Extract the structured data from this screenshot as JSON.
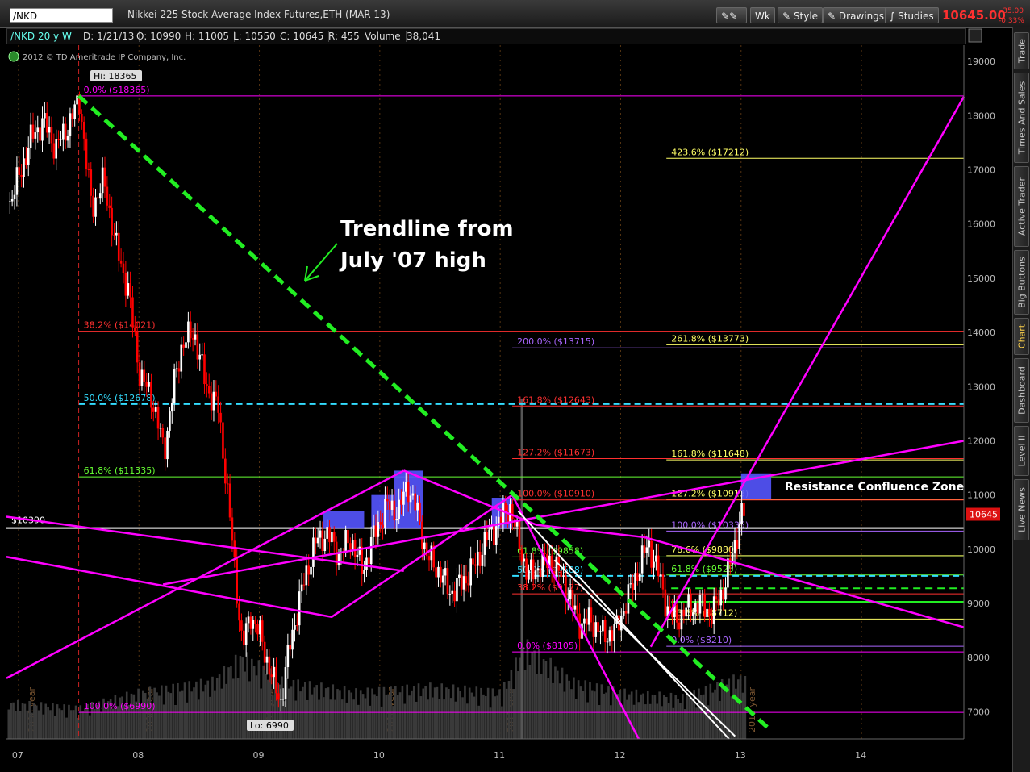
{
  "toolbar": {
    "symbol": "/NKD",
    "description": "Nikkei 225 Stock Average Index Futures,ETH (MAR 13)",
    "period_button": "Wk",
    "style_button": "Style",
    "drawings_button": "Drawings",
    "studies_button": "Studies",
    "last_price": "10645.00",
    "net_change": "-35.00",
    "pct_change": "-0.33%"
  },
  "infobar": {
    "symbol_period": "/NKD 20 y W",
    "date": "D: 1/21/13",
    "open": "O: 10990",
    "high": "H: 11005",
    "low": "L: 10550",
    "close": "C: 10645",
    "range": "R: 455",
    "volume_label": "Volume",
    "volume": "38,041"
  },
  "copyright": "2012 © TD Ameritrade IP Company, Inc.",
  "side_tabs": [
    "Trade",
    "Times And Sales",
    "Active Trader",
    "Big Buttons",
    "Chart",
    "Dashboard",
    "Level II",
    "Live News"
  ],
  "colors": {
    "bull": "#ffffff",
    "bear": "#ff0000",
    "fib_magenta": "#ff00ff",
    "fib_red": "#ff3030",
    "fib_yellow": "#ffff66",
    "fib_green": "#66ff33",
    "fib_cyan": "#33ddff",
    "fib_violet": "#aa66ff",
    "trend_green": "#22ee22",
    "zone_blue": "#5555ff",
    "volume": "#3a3a3a"
  },
  "chart_data": {
    "type": "candlestick",
    "instrument": "/NKD",
    "x_ticks": [
      "07",
      "08",
      "09",
      "10",
      "11",
      "12",
      "13",
      "14"
    ],
    "year_labels": [
      "2006 year",
      "2008 year",
      "2009 year",
      "2010 year",
      "2011 year",
      "2013 year"
    ],
    "y_ticks": [
      7000,
      8000,
      9000,
      10000,
      11000,
      12000,
      13000,
      14000,
      15000,
      16000,
      17000,
      18000,
      19000
    ],
    "ylim": [
      6500,
      19300
    ],
    "xlim": [
      2006.9,
      2014.85
    ],
    "high_label": "Hi: 18365",
    "low_label": "Lo: 6990",
    "current_price_label": "10645",
    "price_line_label": "$10390",
    "price_line_value": 10390,
    "price_path": [
      [
        2006.92,
        16400
      ],
      [
        2007.0,
        16900
      ],
      [
        2007.1,
        17600
      ],
      [
        2007.2,
        17900
      ],
      [
        2007.3,
        17400
      ],
      [
        2007.4,
        17800
      ],
      [
        2007.5,
        18300
      ],
      [
        2007.55,
        17200
      ],
      [
        2007.6,
        16300
      ],
      [
        2007.7,
        16800
      ],
      [
        2007.8,
        15600
      ],
      [
        2007.9,
        14800
      ],
      [
        2008.0,
        13200
      ],
      [
        2008.1,
        12800
      ],
      [
        2008.2,
        11800
      ],
      [
        2008.28,
        13000
      ],
      [
        2008.35,
        13800
      ],
      [
        2008.45,
        14000
      ],
      [
        2008.55,
        13000
      ],
      [
        2008.65,
        12600
      ],
      [
        2008.72,
        11200
      ],
      [
        2008.78,
        9800
      ],
      [
        2008.85,
        8200
      ],
      [
        2008.92,
        8800
      ],
      [
        2009.0,
        8400
      ],
      [
        2009.1,
        7600
      ],
      [
        2009.17,
        7200
      ],
      [
        2009.25,
        8300
      ],
      [
        2009.35,
        9300
      ],
      [
        2009.45,
        10100
      ],
      [
        2009.55,
        10300
      ],
      [
        2009.65,
        9900
      ],
      [
        2009.75,
        10200
      ],
      [
        2009.85,
        9600
      ],
      [
        2009.95,
        10300
      ],
      [
        2010.05,
        10800
      ],
      [
        2010.15,
        10700
      ],
      [
        2010.22,
        11200
      ],
      [
        2010.3,
        10700
      ],
      [
        2010.38,
        9900
      ],
      [
        2010.48,
        9600
      ],
      [
        2010.58,
        9200
      ],
      [
        2010.68,
        9400
      ],
      [
        2010.78,
        9700
      ],
      [
        2010.88,
        10200
      ],
      [
        2010.98,
        10500
      ],
      [
        2011.07,
        10800
      ],
      [
        2011.15,
        10100
      ],
      [
        2011.22,
        9500
      ],
      [
        2011.32,
        9700
      ],
      [
        2011.4,
        9800
      ],
      [
        2011.5,
        9500
      ],
      [
        2011.58,
        9000
      ],
      [
        2011.66,
        8600
      ],
      [
        2011.74,
        8700
      ],
      [
        2011.85,
        8400
      ],
      [
        2011.95,
        8500
      ],
      [
        2012.05,
        9100
      ],
      [
        2012.15,
        9700
      ],
      [
        2012.22,
        10100
      ],
      [
        2012.3,
        9600
      ],
      [
        2012.38,
        8900
      ],
      [
        2012.45,
        8700
      ],
      [
        2012.55,
        8900
      ],
      [
        2012.65,
        9000
      ],
      [
        2012.75,
        8800
      ],
      [
        2012.85,
        9300
      ],
      [
        2012.92,
        9900
      ],
      [
        2013.0,
        10700
      ],
      [
        2013.03,
        10645
      ]
    ],
    "volume_path": [
      [
        2006.92,
        0.35
      ],
      [
        2007.5,
        0.3
      ],
      [
        2008.0,
        0.45
      ],
      [
        2008.6,
        0.55
      ],
      [
        2008.85,
        0.8
      ],
      [
        2009.2,
        0.55
      ],
      [
        2009.8,
        0.45
      ],
      [
        2010.4,
        0.5
      ],
      [
        2011.0,
        0.45
      ],
      [
        2011.2,
        0.9
      ],
      [
        2011.6,
        0.55
      ],
      [
        2012.0,
        0.45
      ],
      [
        2012.5,
        0.4
      ],
      [
        2013.0,
        0.6
      ],
      [
        2013.03,
        0.55
      ]
    ],
    "volume_spike": {
      "x": 2011.17,
      "top": 12770
    },
    "fib_levels": [
      {
        "label": "0.0%",
        "price_text": "($18365)",
        "value": 18365,
        "x1": 2007.5,
        "x2": 2014.85,
        "color": "#ff00ff"
      },
      {
        "label": "38.2%",
        "price_text": "($14021)",
        "value": 14021,
        "x1": 2007.5,
        "x2": 2014.85,
        "color": "#ff3030"
      },
      {
        "label": "50.0%",
        "price_text": "($12678)",
        "value": 12678,
        "x1": 2007.5,
        "x2": 2014.85,
        "color": "#33ddff",
        "dashed": true
      },
      {
        "label": "61.8%",
        "price_text": "($11335)",
        "value": 11335,
        "x1": 2007.5,
        "x2": 2014.85,
        "color": "#66ff33"
      },
      {
        "label": "100.0%",
        "price_text": "($6990)",
        "value": 6990,
        "x1": 2007.5,
        "x2": 2014.85,
        "color": "#ff00ff"
      },
      {
        "label": "423.6%",
        "price_text": "($17212)",
        "value": 17212,
        "x1": 2012.38,
        "x2": 2014.85,
        "color": "#ffff66"
      },
      {
        "label": "261.8%",
        "price_text": "($13773)",
        "value": 13773,
        "x1": 2012.38,
        "x2": 2014.85,
        "color": "#ffff66"
      },
      {
        "label": "200.0%",
        "price_text": "($13715)",
        "value": 13715,
        "x1": 2011.1,
        "x2": 2014.85,
        "color": "#aa66ff"
      },
      {
        "label": "161.8%",
        "price_text": "($12643)",
        "value": 12643,
        "x1": 2011.1,
        "x2": 2014.85,
        "color": "#ff3030"
      },
      {
        "label": "127.2%",
        "price_text": "($11673)",
        "value": 11673,
        "x1": 2011.1,
        "x2": 2014.85,
        "color": "#ff3030"
      },
      {
        "label": "161.8%",
        "price_text": "($11648)",
        "value": 11648,
        "x1": 2012.38,
        "x2": 2014.85,
        "color": "#ffff66"
      },
      {
        "label": "127.2%",
        "price_text": "($10913)",
        "value": 10913,
        "x1": 2012.38,
        "x2": 2014.85,
        "color": "#ffff66"
      },
      {
        "label": "100.0%",
        "price_text": "($10910)",
        "value": 10910,
        "x1": 2011.1,
        "x2": 2014.85,
        "color": "#ff3030"
      },
      {
        "label": "100.0%",
        "price_text": "($10335)",
        "value": 10335,
        "x1": 2012.38,
        "x2": 2014.85,
        "color": "#aa66ff"
      },
      {
        "label": "78.6%",
        "price_text": "($9880)",
        "value": 9880,
        "x1": 2012.38,
        "x2": 2014.85,
        "color": "#ffff66"
      },
      {
        "label": "61.8%",
        "price_text": "($9858)",
        "value": 9858,
        "x1": 2011.1,
        "x2": 2014.85,
        "color": "#66ff33"
      },
      {
        "label": "61.8%",
        "price_text": "($9525)",
        "value": 9525,
        "x1": 2012.38,
        "x2": 2014.85,
        "color": "#66ff33"
      },
      {
        "label": "50.0%",
        "price_text": "($9508)",
        "value": 9508,
        "x1": 2011.1,
        "x2": 2014.85,
        "color": "#33ddff",
        "dashed": true
      },
      {
        "label": "38.2%",
        "price_text": "($9177)",
        "value": 9177,
        "x1": 2011.1,
        "x2": 2014.85,
        "color": "#ff3030"
      },
      {
        "label": "23.6%",
        "price_text": "($8712)",
        "value": 8712,
        "x1": 2012.38,
        "x2": 2014.85,
        "color": "#ffff66"
      },
      {
        "label": "0.0%",
        "price_text": "($8210)",
        "value": 8210,
        "x1": 2012.38,
        "x2": 2014.85,
        "color": "#aa66ff"
      },
      {
        "label": "0.0%",
        "price_text": "($8105)",
        "value": 8105,
        "x1": 2011.1,
        "x2": 2014.85,
        "color": "#ff00ff"
      }
    ],
    "extra_levels": [
      {
        "value": 9280,
        "x1": 2012.42,
        "x2": 2014.85,
        "color": "#22ee22",
        "dashed": true
      },
      {
        "value": 9030,
        "x1": 2012.42,
        "x2": 2014.85,
        "color": "#22ee22",
        "dashed": false
      }
    ],
    "trendline": {
      "from": [
        2007.5,
        18365
      ],
      "to": [
        2013.25,
        6650
      ],
      "color": "#22ee22"
    },
    "magenta_lines": [
      {
        "from": [
          2006.9,
          7620
        ],
        "to": [
          2010.2,
          11450
        ]
      },
      {
        "from": [
          2010.2,
          11450
        ],
        "to": [
          2011.3,
          10450
        ]
      },
      {
        "from": [
          2011.3,
          10450
        ],
        "to": [
          2012.2,
          10220
        ]
      },
      {
        "from": [
          2012.2,
          10220
        ],
        "to": [
          2014.85,
          8560
        ]
      },
      {
        "from": [
          2006.9,
          9860
        ],
        "to": [
          2009.6,
          8750
        ]
      },
      {
        "from": [
          2009.6,
          8750
        ],
        "to": [
          2011.1,
          11000
        ]
      },
      {
        "from": [
          2011.1,
          11000
        ],
        "to": [
          2012.15,
          6500
        ]
      },
      {
        "from": [
          2008.2,
          9350
        ],
        "to": [
          2014.85,
          12000
        ]
      },
      {
        "from": [
          2012.25,
          8200
        ],
        "to": [
          2014.85,
          18350
        ]
      },
      {
        "from": [
          2006.9,
          10600
        ],
        "to": [
          2010.2,
          9600
        ]
      }
    ],
    "white_channel": [
      {
        "from": [
          2011.15,
          10700
        ],
        "to": [
          2012.9,
          6500
        ]
      },
      {
        "from": [
          2011.45,
          9800
        ],
        "to": [
          2012.95,
          6550
        ]
      }
    ],
    "zone_boxes": [
      {
        "x1": 2009.53,
        "x2": 2009.87,
        "y1": 10380,
        "y2": 10700
      },
      {
        "x1": 2009.93,
        "x2": 2010.12,
        "y1": 10380,
        "y2": 11000
      },
      {
        "x1": 2010.12,
        "x2": 2010.36,
        "y1": 10380,
        "y2": 11450
      },
      {
        "x1": 2010.93,
        "x2": 2011.1,
        "y1": 10380,
        "y2": 10950
      },
      {
        "x1": 2013.0,
        "x2": 2013.25,
        "y1": 10930,
        "y2": 11400
      }
    ],
    "annotations": {
      "trendline_text_1": "Trendline from",
      "trendline_text_2": "July '07 high",
      "resistance_text": "Resistance Confluence Zone"
    },
    "grid": "vertical dotted"
  }
}
